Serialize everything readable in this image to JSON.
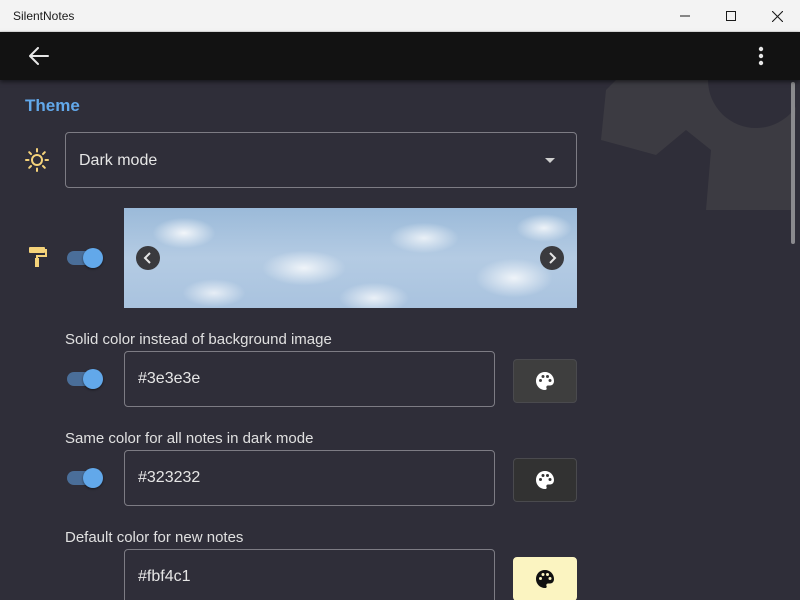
{
  "window": {
    "title": "SilentNotes",
    "minimize_icon": "minimize-icon",
    "maximize_icon": "maximize-icon",
    "close_icon": "close-icon"
  },
  "appbar": {
    "back_icon": "arrow-left-icon",
    "menu_icon": "more-vertical-icon"
  },
  "theme": {
    "section_title": "Theme",
    "mode_select": {
      "icon": "sun-icon",
      "value": "Dark mode"
    },
    "background_image": {
      "icon": "paint-roller-icon",
      "toggle_on": true,
      "prev_icon": "chevron-left-icon",
      "next_icon": "chevron-right-icon"
    },
    "solid_color": {
      "label": "Solid color instead of background image",
      "toggle_on": true,
      "value": "#3e3e3e",
      "button_icon": "palette-icon",
      "swatch": "#3e3e3e"
    },
    "same_color_dark": {
      "label": "Same color for all notes in dark mode",
      "toggle_on": true,
      "value": "#323232",
      "button_icon": "palette-icon",
      "swatch": "#323232"
    },
    "default_note_color": {
      "label": "Default color for new notes",
      "value": "#fbf4c1",
      "button_icon": "palette-icon",
      "swatch": "#fbf4c1"
    }
  },
  "colors": {
    "accent": "#62a8ea",
    "icon_yellow": "#f5d37a",
    "background": "#2f2e39",
    "appbar": "#121212"
  }
}
